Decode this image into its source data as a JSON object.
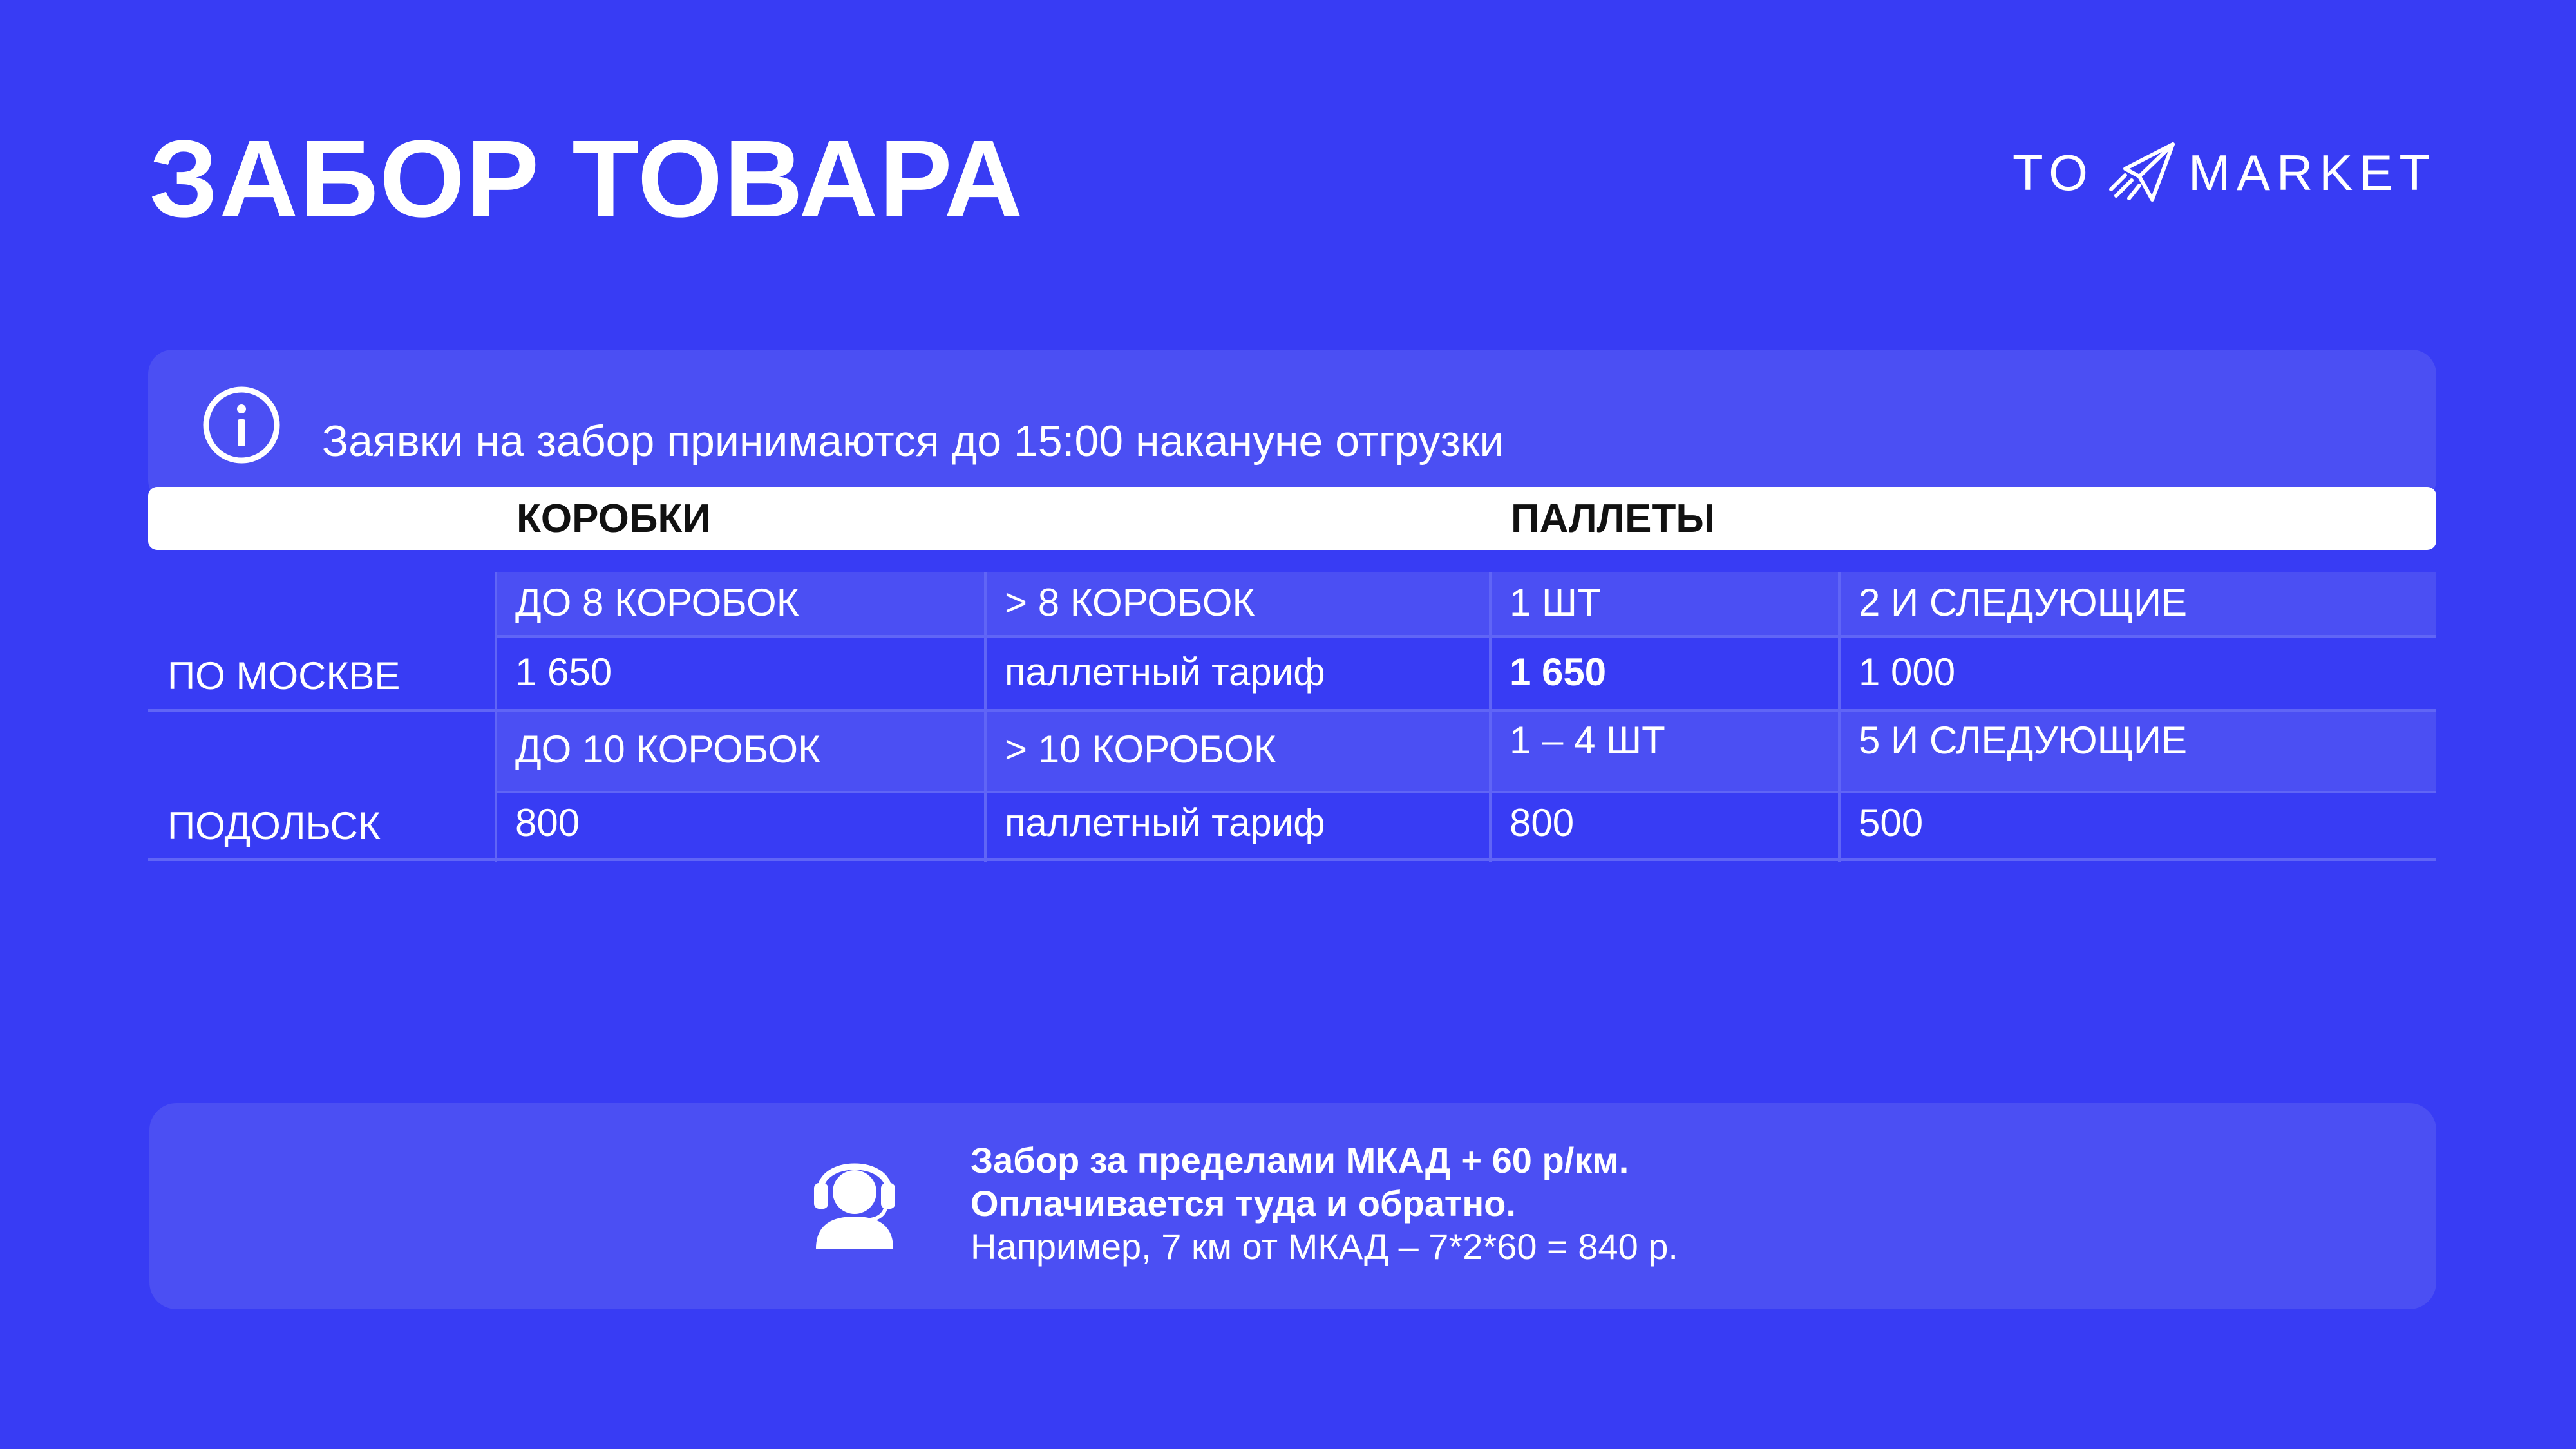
{
  "title": "ЗАБОР ТОВАРА",
  "logo": {
    "left": "TO",
    "right": "MARKET",
    "icon": "paper-plane-icon"
  },
  "info": {
    "text": "Заявки на забор принимаются до 15:00 накануне отгрузки",
    "icon": "info-icon"
  },
  "table": {
    "group_headers": [
      "КОРОБКИ",
      "ПАЛЛЕТЫ"
    ],
    "rows": [
      {
        "city": "ПО МОСКВЕ",
        "headers": [
          "ДО 8 КОРОБОК",
          "> 8 КОРОБОК",
          "1 ШТ",
          "2 И СЛЕДУЮЩИЕ"
        ],
        "values": [
          "1 650",
          "паллетный тариф",
          "1 650",
          "1 000"
        ]
      },
      {
        "city": "ПОДОЛЬСК",
        "headers": [
          "ДО 10 КОРОБОК",
          "> 10 КОРОБОК",
          "1 – 4 ШТ",
          "5 И СЛЕДУЮЩИЕ"
        ],
        "values": [
          "800",
          "паллетный тариф",
          "800",
          "500"
        ]
      }
    ]
  },
  "note": {
    "icon": "support-agent-icon",
    "line1": "Забор за пределами МКАД + 60 р/км.",
    "line2": "Оплачивается туда и обратно.",
    "line3": "Например, 7 км от МКАД – 7*2*60 = 840 р."
  },
  "colors": {
    "background": "#383cf4",
    "panel": "#4b4ff3",
    "header_bar": "#ffffff"
  }
}
